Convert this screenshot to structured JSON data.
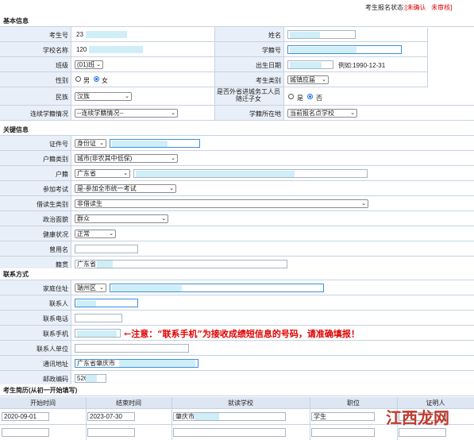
{
  "status": {
    "label": "考生报名状态:",
    "confirm": "[未确认",
    "review": "未审核]"
  },
  "sections": {
    "basic": "基本信息",
    "key": "关键信息",
    "contact": "联系方式",
    "history": "考生简历(从初一开始填写)"
  },
  "basic": {
    "exam_no_label": "考生号",
    "exam_no_value": "23",
    "name_label": "姓名",
    "school_name_label": "学校名称",
    "school_name_value": "120",
    "student_no_label": "学籍号",
    "class_label": "班级",
    "class_value": "(01)班",
    "birth_label": "出生日期",
    "birth_example": "例如:1990-12-31",
    "gender_label": "性别",
    "gender_male": "男",
    "gender_female": "女",
    "gender_selected": "女",
    "category_label": "考生类别",
    "category_value": "城镇应届",
    "ethnic_label": "民族",
    "ethnic_value": "汉族",
    "migrant_label": "是否外省进城务工人员随迁子女",
    "migrant_yes": "是",
    "migrant_no": "否",
    "migrant_selected": "否",
    "continue_label": "连续学籍情况",
    "continue_value": "--连续学籍情况--",
    "roll_place_label": "学籍所在地",
    "roll_place_value": "当前报名点学校"
  },
  "key": {
    "id_label": "证件号",
    "id_type": "身份证",
    "hukou_type_label": "户籍类别",
    "hukou_type_value": "城市(非农其中低保)",
    "hukou_label": "户籍",
    "hukou_value": "广东省",
    "exam_type_label": "参加考试",
    "exam_type_value": "是-参加全市统一考试",
    "boarding_label": "借读生类别",
    "boarding_value": "非借读生",
    "political_label": "政治面貌",
    "political_value": "群众",
    "health_label": "健康状况",
    "health_value": "正常",
    "former_name_label": "曾用名",
    "origin_label": "籍贯",
    "origin_value": "广东省"
  },
  "contact": {
    "address_label": "家庭住址",
    "address_district": "端州区",
    "contact_person_label": "联系人",
    "phone_label": "联系电话",
    "mobile_label": "联系手机",
    "mobile_note": "←注意：“联系手机”为接收成绩短信息的号码，请准确填报！",
    "unit_label": "联系人单位",
    "mail_addr_label": "通讯地址",
    "mail_addr_value": "广东省肇庆市",
    "postcode_label": "邮政编码",
    "postcode_value": "526"
  },
  "history": {
    "headers": [
      "开始时间",
      "结束时间",
      "就读学校",
      "职位",
      "证明人"
    ],
    "rows": [
      {
        "start": "2020-09-01",
        "end": "2023-07-30",
        "school": "肇庆市",
        "position": "学生",
        "witness": ""
      },
      {
        "start": "",
        "end": "",
        "school": "",
        "position": "",
        "witness": ""
      }
    ]
  },
  "watermark": "江西龙网"
}
